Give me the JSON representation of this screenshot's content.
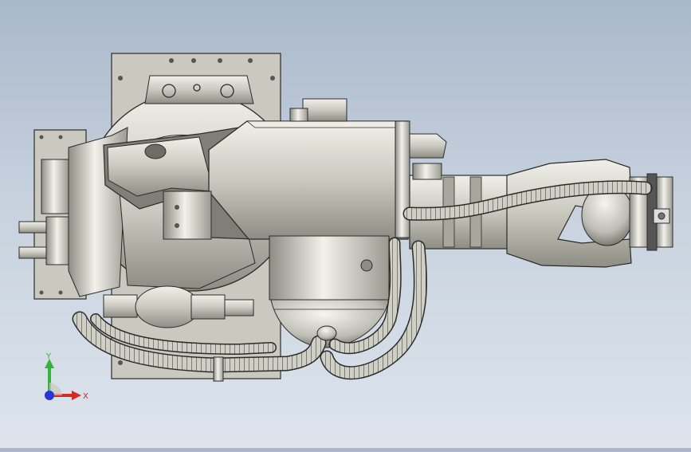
{
  "viewport": {
    "background_top": "#a9b8ca",
    "background_bottom": "#dde4ec",
    "model": {
      "metal_light": "#e4e4dc",
      "metal_mid": "#bdbdb4",
      "metal_dark": "#8f8f86",
      "outline": "#2b2b2b"
    }
  },
  "triad": {
    "y_label": "Y",
    "x_label": "X",
    "y_color": "#36b33a",
    "x_color": "#d42a22",
    "z_color": "#2a36d4"
  }
}
